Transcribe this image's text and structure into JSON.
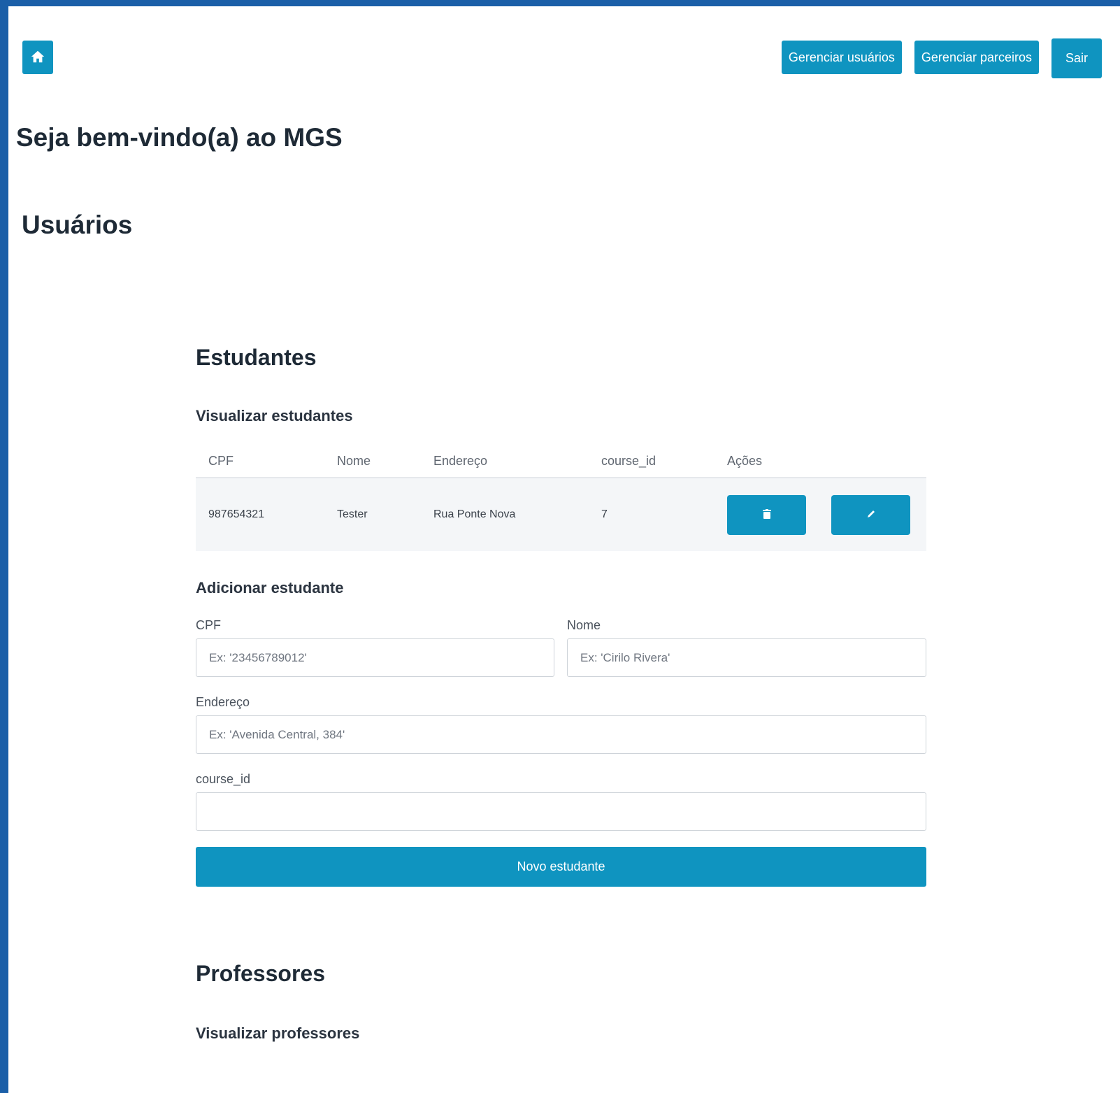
{
  "header": {
    "home_icon": "home-icon",
    "buttons": [
      "Gerenciar usuários",
      "Gerenciar parceiros",
      "Sair"
    ]
  },
  "welcome": "Seja bem-vindo(a) ao MGS",
  "section_title": "Usuários",
  "students": {
    "title": "Estudantes",
    "view_title": "Visualizar estudantes",
    "columns": [
      "CPF",
      "Nome",
      "Endereço",
      "course_id",
      "Ações"
    ],
    "rows": [
      {
        "cpf": "987654321",
        "nome": "Tester",
        "endereco": "Rua Ponte Nova",
        "course_id": "7"
      }
    ],
    "row_actions": [
      "trash-icon",
      "pencil-icon"
    ],
    "add_title": "Adicionar estudante",
    "form": {
      "cpf_label": "CPF",
      "cpf_placeholder": "Ex: '23456789012'",
      "nome_label": "Nome",
      "nome_placeholder": "Ex: 'Cirilo Rivera'",
      "endereco_label": "Endereço",
      "endereco_placeholder": "Ex: 'Avenida Central, 384'",
      "course_label": "course_id",
      "course_placeholder": "",
      "submit": "Novo estudante"
    }
  },
  "professors": {
    "title": "Professores",
    "view_title": "Visualizar professores"
  },
  "colors": {
    "accent": "#0f94c0",
    "frame": "#1b5fa8",
    "text": "#1e2a36"
  }
}
